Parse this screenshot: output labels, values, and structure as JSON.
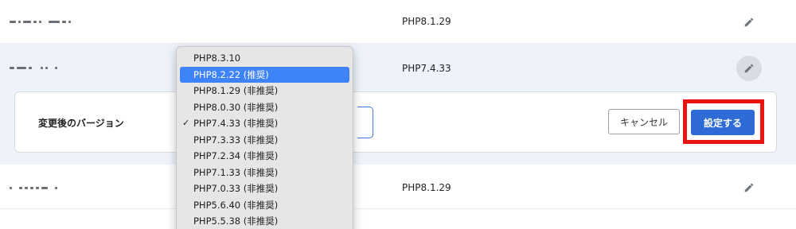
{
  "rows": [
    {
      "php_version": "PHP8.1.29"
    },
    {
      "php_version": "PHP7.4.33"
    },
    {
      "php_version": "PHP8.1.29"
    }
  ],
  "panel": {
    "label": "変更後のバージョン",
    "cancel_label": "キャンセル",
    "submit_label": "設定する"
  },
  "dropdown": {
    "options": [
      "PHP8.3.10",
      "PHP8.2.22 (推奨)",
      "PHP8.1.29 (非推奨)",
      "PHP8.0.30 (非推奨)",
      "PHP7.4.33 (非推奨)",
      "PHP7.3.33 (非推奨)",
      "PHP7.2.34 (非推奨)",
      "PHP7.1.33 (非推奨)",
      "PHP7.0.33 (非推奨)",
      "PHP5.6.40 (非推奨)",
      "PHP5.5.38 (非推奨)"
    ],
    "checkmark": "✓",
    "highlighted_option": "PHP8.2.22 (推奨)",
    "checked_option": "PHP7.4.33 (非推奨)"
  },
  "icons": {
    "edit": "pencil-icon",
    "check": "checkmark-icon"
  },
  "colors": {
    "accent": "#2f6bd6",
    "highlight_border": "#e8140f",
    "dropdown_highlight": "#3f83f8",
    "row_selected_bg": "#eef3fb"
  }
}
